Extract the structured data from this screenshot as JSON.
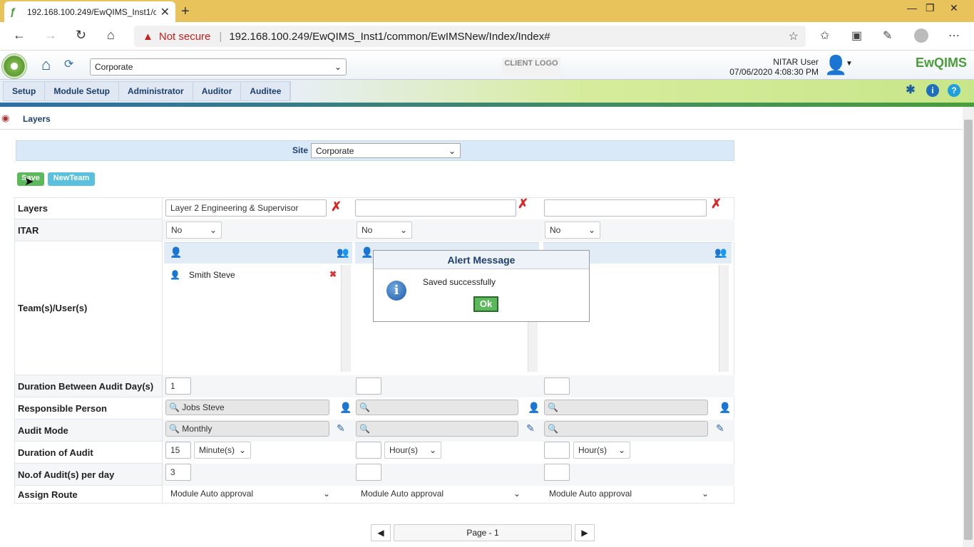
{
  "browser": {
    "tab_title": "192.168.100.249/EwQIMS_Inst1/c",
    "warning": "Not secure",
    "url": "192.168.100.249/EwQIMS_Inst1/common/EwIMSNew/Index/Index#"
  },
  "header": {
    "site_select": "Corporate",
    "client_logo": "CLIENT LOGO",
    "user_name": "NITAR User",
    "datetime": "07/06/2020 4:08:30 PM",
    "brand": "EwQIMS"
  },
  "menu": [
    "Setup",
    "Module Setup",
    "Administrator",
    "Auditor",
    "Auditee"
  ],
  "breadcrumb": "Layers",
  "site": {
    "label": "Site",
    "value": "Corporate"
  },
  "buttons": {
    "save": "Save",
    "new_team": "NewTeam"
  },
  "row_labels": [
    "Layers",
    "ITAR",
    "Team(s)/User(s)",
    "Duration Between Audit Day(s)",
    "Responsible Person",
    "Audit Mode",
    "Duration of Audit",
    "No.of Audit(s) per day",
    "Assign Route"
  ],
  "columns": [
    {
      "layer": "Layer 2 Engineering & Supervisor",
      "itar": "No",
      "team_user": "Smith Steve",
      "duration_between": "1",
      "responsible": "Jobs Steve",
      "audit_mode": "Monthly",
      "duration": "15",
      "duration_unit": "Minute(s)",
      "audits_per_day": "3",
      "route": "Module Auto approval"
    },
    {
      "layer": "",
      "itar": "No",
      "team_user": "",
      "duration_between": "",
      "responsible": "",
      "audit_mode": "",
      "duration": "",
      "duration_unit": "Hour(s)",
      "audits_per_day": "",
      "route": "Module Auto approval"
    },
    {
      "layer": "",
      "itar": "No",
      "team_user": "",
      "duration_between": "",
      "responsible": "",
      "audit_mode": "",
      "duration": "",
      "duration_unit": "Hour(s)",
      "audits_per_day": "",
      "route": "Module Auto approval"
    }
  ],
  "alert": {
    "title": "Alert Message",
    "message": "Saved successfully",
    "ok": "Ok"
  },
  "pager": {
    "text": "Page - 1"
  }
}
